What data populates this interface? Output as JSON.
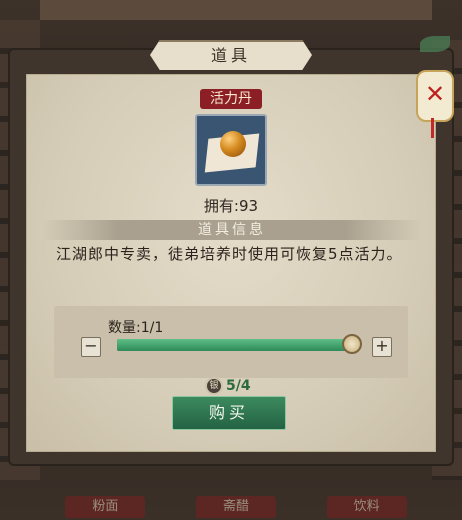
{
  "dialog": {
    "title": "道具",
    "item_name": "活力丹",
    "owned": "拥有:93",
    "section_title": "道具信息",
    "description": "江湖郎中专卖，徒弟培养时使用可恢复5点活力。"
  },
  "quantity": {
    "label": "数量:1/1",
    "minus": "−",
    "plus": "+",
    "fill_fraction": 1.0
  },
  "cost": {
    "coin_glyph": "银",
    "text": "5/4"
  },
  "buy_button": "购买",
  "background_tabs": [
    "粉面",
    "斋醋",
    "饮料"
  ],
  "icons": {
    "close": "close-x-icon",
    "coin": "coin-icon",
    "item": "pill-icon"
  },
  "colors": {
    "accent_green": "#2e8a58",
    "name_tag_red": "#8c1f25",
    "close_red": "#c02020"
  }
}
